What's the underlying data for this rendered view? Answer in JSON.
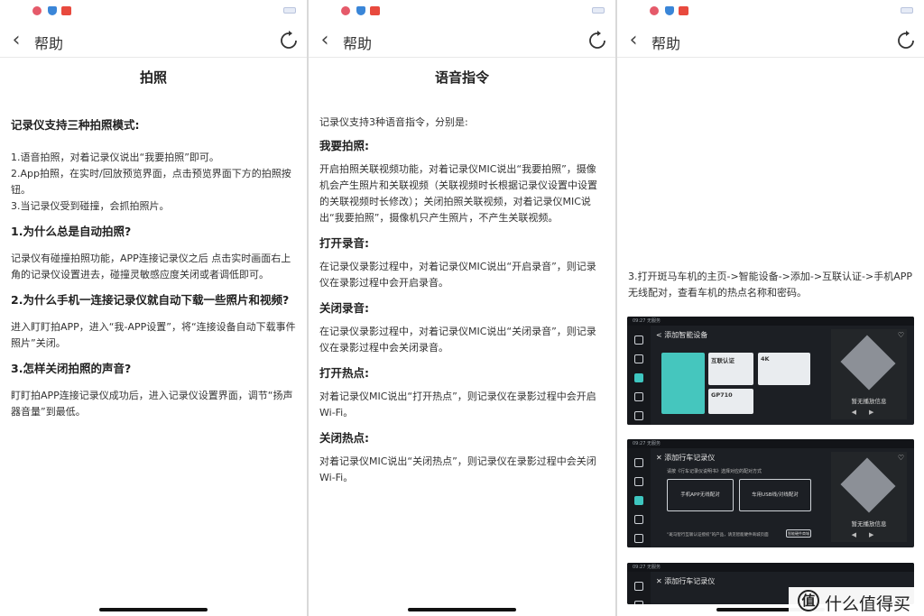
{
  "header": {
    "title": "帮助"
  },
  "panel1": {
    "page_title": "拍照",
    "intro_heading": "记录仪支持三种拍照模式:",
    "modes": [
      "1.语音拍照，对着记录仪说出“我要拍照”即可。",
      "2.App拍照，在实时/回放预览界面，点击预览界面下方的拍照按钮。",
      "3.当记录仪受到碰撞，会抓拍照片。"
    ],
    "faq": [
      {
        "q": "1.为什么总是自动拍照?",
        "a": "记录仪有碰撞拍照功能，APP连接记录仪之后 点击实时画面右上角的记录仪设置进去，碰撞灵敏感应度关闭或者调低即可。"
      },
      {
        "q": "2.为什么手机一连接记录仪就自动下载一些照片和视频?",
        "a": "进入盯盯拍APP，进入“我-APP设置”，将“连接设备自动下载事件照片”关闭。"
      },
      {
        "q": "3.怎样关闭拍照的声音?",
        "a": "盯盯拍APP连接记录仪成功后，进入记录仪设置界面，调节“扬声器音量”到最低。"
      }
    ]
  },
  "panel2": {
    "page_title": "语音指令",
    "intro": "记录仪支持3种语音指令，分别是:",
    "sections": [
      {
        "h": "我要拍照:",
        "t": "开启拍照关联视频功能，对着记录仪MIC说出“我要拍照”，摄像机会产生照片和关联视频（关联视频时长根据记录仪设置中设置的关联视频时长修改）；关闭拍照关联视频，对着记录仪MIC说出“我要拍照”，摄像机只产生照片，不产生关联视频。"
      },
      {
        "h": "打开录音:",
        "t": "在记录仪录影过程中，对着记录仪MIC说出“开启录音”，则记录仪在录影过程中会开启录音。"
      },
      {
        "h": "关闭录音:",
        "t": "在记录仪录影过程中，对着记录仪MIC说出“关闭录音”，则记录仪在录影过程中会关闭录音。"
      },
      {
        "h": "打开热点:",
        "t": "对着记录仪MIC说出“打开热点”，则记录仪在录影过程中会开启Wi-Fi。"
      },
      {
        "h": "关闭热点:",
        "t": "对着记录仪MIC说出“关闭热点”，则记录仪在录影过程中会关闭Wi-Fi。"
      }
    ]
  },
  "panel3": {
    "step": "3.打开斑马车机的主页->智能设备->添加->互联认证->手机APP无线配对，查看车机的热点名称和密码。",
    "shot1": {
      "status": "09:27  无服务",
      "title": "< 添加智能设备",
      "tile_a": "互联认证",
      "tile_b": "4K",
      "tile_c": "GP710",
      "now_playing": "暂无播放信息"
    },
    "shot2": {
      "status": "09:27  无服务",
      "title": "✕  添加行车记录仪",
      "sub": "请按《行车记录仪说明书》选择对应的配对方式",
      "btn_a": "手机APP无线配对",
      "btn_b": "车用USB线/对线配对",
      "foot": "“斑马智行互联认证授权”的产品，请见智能硬件商城页面",
      "foot_btn": "智能硬件商城",
      "now_playing": "暂无播放信息"
    },
    "shot3": {
      "status": "09:27  无服务",
      "title": "✕  添加行车记录仪"
    }
  },
  "watermark": {
    "mark": "值",
    "text": "什么值得买"
  }
}
